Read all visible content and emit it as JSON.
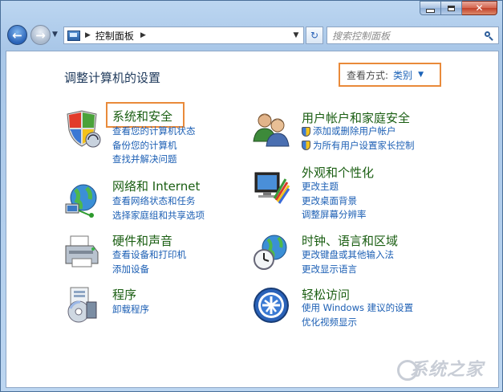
{
  "window": {
    "controls": {
      "minimize": "",
      "maximize": "",
      "close": "✕"
    }
  },
  "nav": {
    "back_icon": "back-arrow-icon",
    "forward_icon": "forward-arrow-icon",
    "address": {
      "path": "控制面板"
    },
    "search": {
      "placeholder": "搜索控制面板"
    }
  },
  "page": {
    "heading": "调整计算机的设置",
    "view_by": {
      "label": "查看方式:",
      "value": "类别"
    }
  },
  "categories": [
    {
      "title": "系统和安全",
      "icon": "security-shield-icon",
      "links": [
        {
          "text": "查看您的计算机状态",
          "shield": false
        },
        {
          "text": "备份您的计算机",
          "shield": false
        },
        {
          "text": "查找并解决问题",
          "shield": false
        }
      ]
    },
    {
      "title": "网络和 Internet",
      "icon": "network-globe-icon",
      "links": [
        {
          "text": "查看网络状态和任务",
          "shield": false
        },
        {
          "text": "选择家庭组和共享选项",
          "shield": false
        }
      ]
    },
    {
      "title": "硬件和声音",
      "icon": "printer-icon",
      "links": [
        {
          "text": "查看设备和打印机",
          "shield": false
        },
        {
          "text": "添加设备",
          "shield": false
        }
      ]
    },
    {
      "title": "程序",
      "icon": "programs-icon",
      "links": [
        {
          "text": "卸载程序",
          "shield": false
        }
      ]
    },
    {
      "title": "用户帐户和家庭安全",
      "icon": "users-icon",
      "links": [
        {
          "text": "添加或删除用户帐户",
          "shield": true
        },
        {
          "text": "为所有用户设置家长控制",
          "shield": true
        }
      ]
    },
    {
      "title": "外观和个性化",
      "icon": "appearance-monitor-icon",
      "links": [
        {
          "text": "更改主题",
          "shield": false
        },
        {
          "text": "更改桌面背景",
          "shield": false
        },
        {
          "text": "调整屏幕分辨率",
          "shield": false
        }
      ]
    },
    {
      "title": "时钟、语言和区域",
      "icon": "clock-globe-icon",
      "links": [
        {
          "text": "更改键盘或其他输入法",
          "shield": false
        },
        {
          "text": "更改显示语言",
          "shield": false
        }
      ]
    },
    {
      "title": "轻松访问",
      "icon": "ease-of-access-icon",
      "links": [
        {
          "text": "使用 Windows 建议的设置",
          "shield": false
        },
        {
          "text": "优化视频显示",
          "shield": false
        }
      ]
    }
  ],
  "watermark": "系统之家"
}
